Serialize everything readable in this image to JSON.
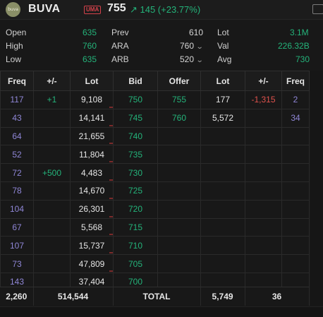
{
  "header": {
    "logo_text": "buva",
    "ticker": "BUVA",
    "badge": "UMA",
    "price": "755",
    "change": "↗ 145 (+23.77%)"
  },
  "stats": {
    "open": {
      "label": "Open",
      "value": "635"
    },
    "high": {
      "label": "High",
      "value": "760"
    },
    "low": {
      "label": "Low",
      "value": "635"
    },
    "prev": {
      "label": "Prev",
      "value": "610"
    },
    "ara": {
      "label": "ARA",
      "value": "760"
    },
    "arb": {
      "label": "ARB",
      "value": "520"
    },
    "lot": {
      "label": "Lot",
      "value": "3.1M"
    },
    "val": {
      "label": "Val",
      "value": "226.32B"
    },
    "avg": {
      "label": "Avg",
      "value": "730"
    }
  },
  "columns": [
    "Freq",
    "+/-",
    "Lot",
    "Bid",
    "Offer",
    "Lot",
    "+/-",
    "Freq"
  ],
  "rows": [
    {
      "bid_freq": "117",
      "bid_chg": "+1",
      "bid_lot": "9,108",
      "bid": "750",
      "offer": "755",
      "offer_lot": "177",
      "offer_chg": "-1,315",
      "offer_freq": "2"
    },
    {
      "bid_freq": "43",
      "bid_chg": "",
      "bid_lot": "14,141",
      "bid": "745",
      "offer": "760",
      "offer_lot": "5,572",
      "offer_chg": "",
      "offer_freq": "34"
    },
    {
      "bid_freq": "64",
      "bid_chg": "",
      "bid_lot": "21,655",
      "bid": "740",
      "offer": "",
      "offer_lot": "",
      "offer_chg": "",
      "offer_freq": ""
    },
    {
      "bid_freq": "52",
      "bid_chg": "",
      "bid_lot": "11,804",
      "bid": "735",
      "offer": "",
      "offer_lot": "",
      "offer_chg": "",
      "offer_freq": ""
    },
    {
      "bid_freq": "72",
      "bid_chg": "+500",
      "bid_lot": "4,483",
      "bid": "730",
      "offer": "",
      "offer_lot": "",
      "offer_chg": "",
      "offer_freq": ""
    },
    {
      "bid_freq": "78",
      "bid_chg": "",
      "bid_lot": "14,670",
      "bid": "725",
      "offer": "",
      "offer_lot": "",
      "offer_chg": "",
      "offer_freq": ""
    },
    {
      "bid_freq": "104",
      "bid_chg": "",
      "bid_lot": "26,301",
      "bid": "720",
      "offer": "",
      "offer_lot": "",
      "offer_chg": "",
      "offer_freq": ""
    },
    {
      "bid_freq": "67",
      "bid_chg": "",
      "bid_lot": "5,568",
      "bid": "715",
      "offer": "",
      "offer_lot": "",
      "offer_chg": "",
      "offer_freq": ""
    },
    {
      "bid_freq": "107",
      "bid_chg": "",
      "bid_lot": "15,737",
      "bid": "710",
      "offer": "",
      "offer_lot": "",
      "offer_chg": "",
      "offer_freq": ""
    },
    {
      "bid_freq": "73",
      "bid_chg": "",
      "bid_lot": "47,809",
      "bid": "705",
      "offer": "",
      "offer_lot": "",
      "offer_chg": "",
      "offer_freq": ""
    },
    {
      "bid_freq": "143",
      "bid_chg": "",
      "bid_lot": "37,404",
      "bid": "700",
      "offer": "",
      "offer_lot": "",
      "offer_chg": "",
      "offer_freq": ""
    }
  ],
  "totals": {
    "bid_freq": "2,260",
    "bid_lot": "514,544",
    "label": "TOTAL",
    "offer_lot": "5,749",
    "offer_freq": "36"
  },
  "colors": {
    "up": "#24b37a",
    "down": "#e0524d",
    "freq": "#8f86d6",
    "background": "#181818"
  }
}
